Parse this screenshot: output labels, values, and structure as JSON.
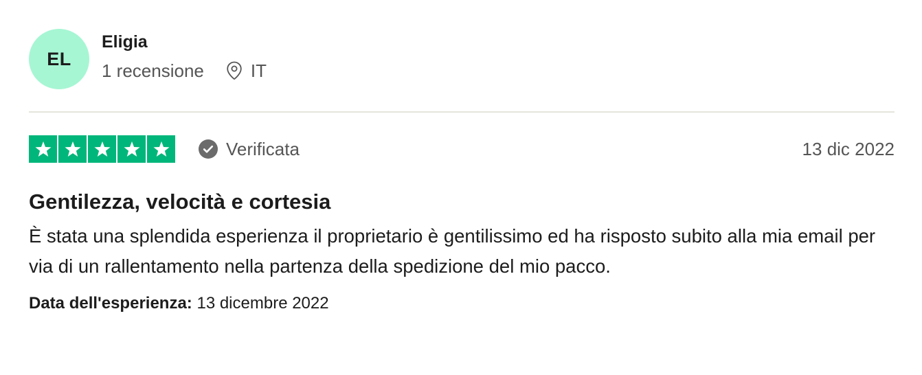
{
  "reviewer": {
    "initials": "EL",
    "name": "Eligia",
    "review_count": "1 recensione",
    "country": "IT",
    "avatar_color": "#a6f6d3"
  },
  "rating": {
    "stars": 5,
    "max_stars": 5,
    "star_color": "#00b67a",
    "verified_label": "Verificata",
    "date": "13 dic 2022"
  },
  "review": {
    "title": "Gentilezza, velocità e cortesia",
    "body": "È stata una splendida esperienza il proprietario è gentilissimo ed ha risposto subito alla mia email per via di un rallentamento nella partenza della spedizione del mio pacco.",
    "experience_label": "Data dell'esperienza:",
    "experience_date": "13 dicembre 2022"
  },
  "icons": {
    "location": "map-pin-icon",
    "verified": "check-circle-icon",
    "star": "star-icon"
  }
}
